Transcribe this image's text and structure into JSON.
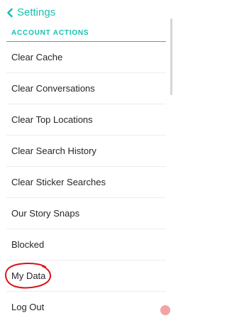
{
  "header": {
    "title": "Settings"
  },
  "section": {
    "title": "ACCOUNT ACTIONS"
  },
  "items": [
    {
      "label": "Clear Cache"
    },
    {
      "label": "Clear Conversations"
    },
    {
      "label": "Clear Top Locations"
    },
    {
      "label": "Clear Search History"
    },
    {
      "label": "Clear Sticker Searches"
    },
    {
      "label": "Our Story Snaps"
    },
    {
      "label": "Blocked"
    },
    {
      "label": "My Data"
    },
    {
      "label": "Log Out"
    }
  ],
  "colors": {
    "accent": "#16c1b0",
    "text": "#262626",
    "annotation": "#d9141b"
  },
  "icons": {
    "back": "chevron-left-icon"
  }
}
